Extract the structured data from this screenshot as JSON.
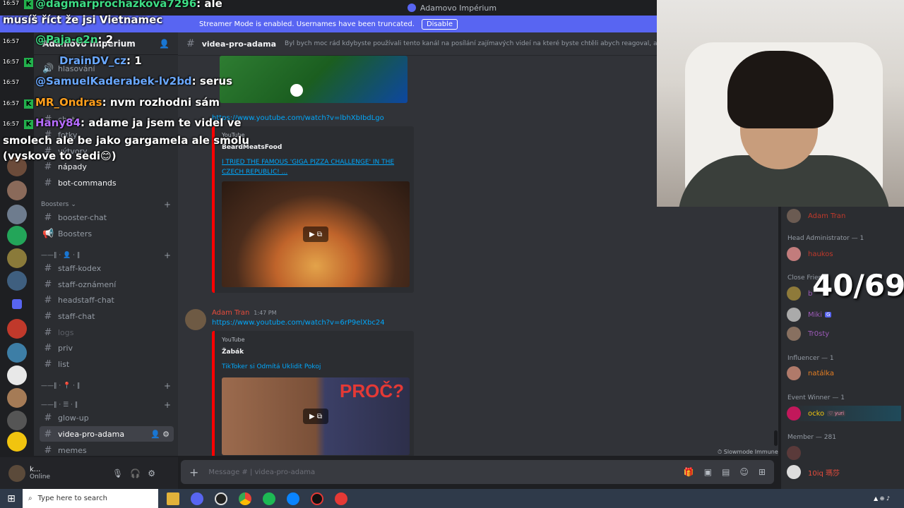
{
  "window": {
    "title": "Adamovo Impérium"
  },
  "banner": {
    "text": "Streamer Mode is enabled. Usernames have been truncated.",
    "disable_label": "Disable"
  },
  "sidebar": {
    "server_name": "Adamovo Impérium",
    "channels": [
      {
        "label": "hlasování"
      },
      {
        "label": "chat"
      },
      {
        "label": "fotky"
      },
      {
        "label": "výtvory"
      },
      {
        "label": "nápady"
      },
      {
        "label": "bot-commands"
      }
    ],
    "boosters_category": "Boosters",
    "booster_channels": [
      {
        "label": "booster-chat"
      },
      {
        "label": "Boosters"
      }
    ],
    "staff_channels": [
      {
        "label": "staff-kodex"
      },
      {
        "label": "staff-oznámení"
      },
      {
        "label": "headstaff-chat"
      },
      {
        "label": "staff-chat"
      },
      {
        "label": "logs"
      },
      {
        "label": "priv"
      },
      {
        "label": "list"
      }
    ],
    "bottom_channels": [
      {
        "label": "glow-up"
      },
      {
        "label": "videa-pro-adama"
      },
      {
        "label": "memes"
      }
    ]
  },
  "user_panel": {
    "name": "k...",
    "status": "Online"
  },
  "chat_header": {
    "channel": "videa-pro-adama",
    "topic": "Byl bych moc rád kdybyste používali tento kanál na posílání zajímavých videí na které byste chtěli abych reagoval, at už je to nějaké dram"
  },
  "messages": {
    "link1": "https://www.youtube.com/watch?v=lbhXbIbdLgo",
    "embed1": {
      "provider": "YouTube",
      "author": "BeardMeatsFood",
      "title": "I TRIED THE FAMOUS 'GIGA PIZZA CHALLENGE' IN THE CZECH REPUBLIC! ..."
    },
    "msg2_author": "Adam Tran",
    "msg2_time": "1:47 PM",
    "link2": "https://www.youtube.com/watch?v=6rP9elXbc24",
    "embed2": {
      "provider": "YouTube",
      "author": "Žabák",
      "title": "TikToker si Odmítá Uklidit Pokoj"
    }
  },
  "slowmode": "Slowmode Immune",
  "composer": {
    "placeholder": "Message # | videa-pro-adama"
  },
  "members": {
    "top_member": "Adam Tran",
    "groups": [
      {
        "label": "Head Administrator — 1",
        "members": [
          "haukos"
        ]
      },
      {
        "label": "Close Frien",
        "members": [
          "b",
          "Miki",
          "Tr0sty"
        ]
      },
      {
        "label": "Influencer — 1",
        "members": [
          "natálka"
        ]
      },
      {
        "label": "Event Winner — 1",
        "members": [
          "ocko"
        ]
      },
      {
        "label": "Member — 281",
        "members": [
          "",
          "10iq 瑪莎"
        ]
      }
    ],
    "ocko_tag": "yuri",
    "miki_tag": "G"
  },
  "overlay": {
    "times": [
      "16:57",
      "16:57",
      "16:57",
      "16:57",
      "16:57",
      "16:57"
    ],
    "lines": [
      {
        "user": "@dagmarprochazkova7296",
        "text": ": ale"
      },
      {
        "user": "",
        "text": "musíš říct že jsi Vietnamec"
      },
      {
        "user": "@Paja-e2n",
        "text": ": 2"
      },
      {
        "user": "DrainDV_cz",
        "text": ": 1"
      },
      {
        "user": "@SamuelKaderabek-lv2bd",
        "text": ": serus"
      },
      {
        "user": "MR_Ondras",
        "text": ": nvm rozhodni sám"
      },
      {
        "user": "Hany84",
        "text": ": adame ja jsem te videl ve"
      },
      {
        "user": "",
        "text": "smolech ale be jako gargamela ale smolu"
      },
      {
        "user": "",
        "text": "(vyskove to sedi😊)"
      }
    ],
    "counter": "40/69"
  },
  "taskbar": {
    "search_placeholder": "Type here to search"
  },
  "colors": {
    "accent": "#5865f2",
    "youtube_red": "#ff0000",
    "link": "#00a8fc",
    "overlay_green": "#3ddc84"
  }
}
